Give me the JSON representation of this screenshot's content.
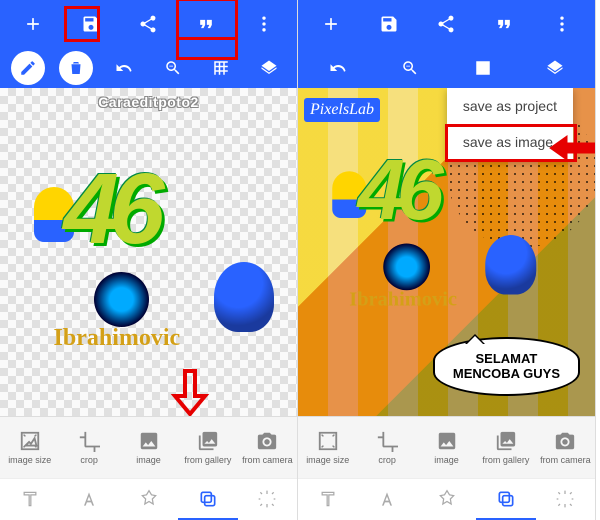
{
  "watermark": "Caraeditpoto2",
  "pixellab_badge": "PixelsLab",
  "artwork": {
    "number": "46",
    "name": "Ibrahimovic"
  },
  "speech_bubble": {
    "line1": "SELAMAT",
    "line2": "MENCOBA GUYS"
  },
  "save_menu": {
    "save_project": "save as project",
    "save_image": "save as image"
  },
  "tools": {
    "image_size": "image size",
    "crop": "crop",
    "image": "image",
    "from_gallery": "from gallery",
    "from_camera": "from camera"
  },
  "colors": {
    "primary": "#2962ff",
    "highlight": "#e60000"
  }
}
